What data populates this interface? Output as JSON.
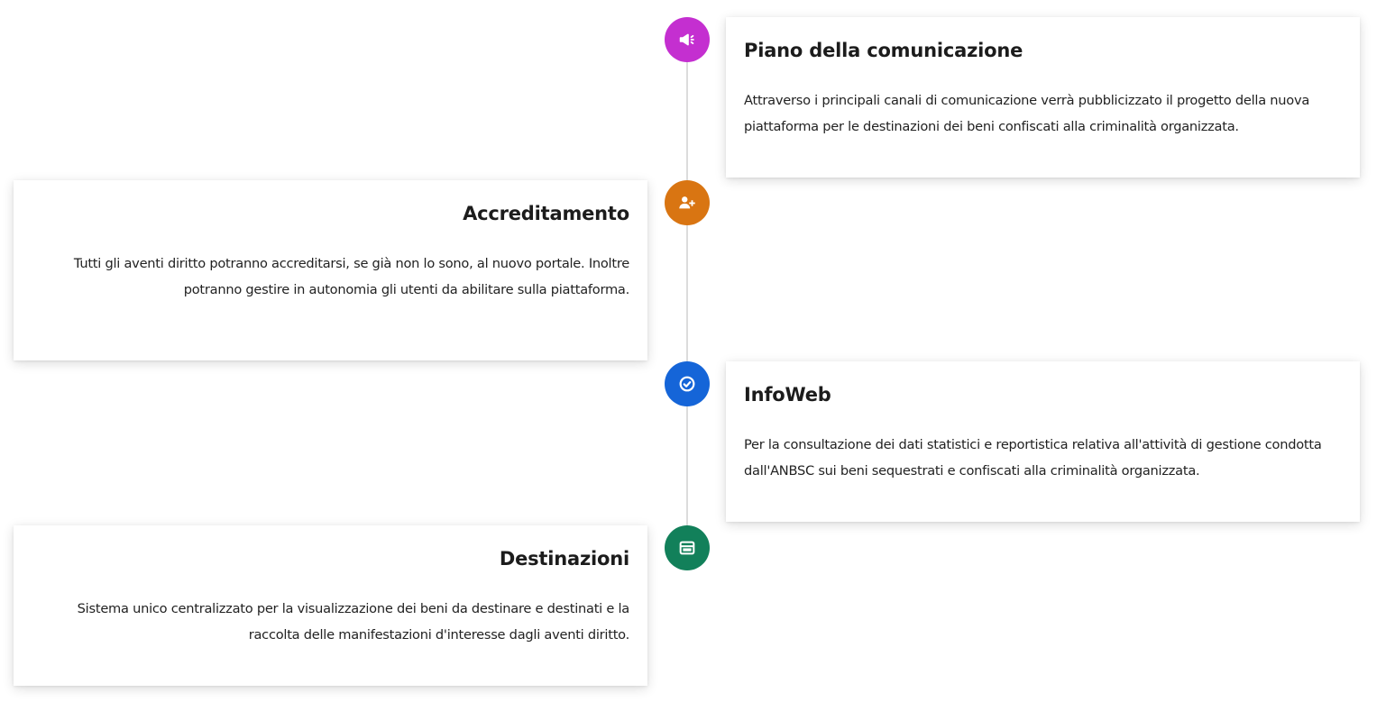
{
  "timeline": {
    "steps": [
      {
        "title": "Piano della comunicazione",
        "text": "Attraverso i principali canali di comunicazione verrà pubblicizzato il progetto della nuova piattaforma per le destinazioni dei beni confiscati alla criminalità organizzata.",
        "icon": "megaphone-icon",
        "color": "#c42fd0"
      },
      {
        "title": "Accreditamento",
        "text": "Tutti gli aventi diritto potranno accreditarsi, se già non lo sono, al nuovo portale. Inoltre potranno gestire in autonomia gli utenti da abilitare sulla piattaforma.",
        "icon": "user-add-icon",
        "color": "#d97512"
      },
      {
        "title": "InfoWeb",
        "text": "Per la consultazione dei dati statistici e reportistica relativa all'attività di gestione condotta dall'ANBSC sui beni sequestrati e confiscati alla criminalità organizzata.",
        "icon": "check-circle-icon",
        "color": "#1565d8"
      },
      {
        "title": "Destinazioni",
        "text": "Sistema unico centralizzato per la visualizzazione dei beni da destinare e destinati e la raccolta delle manifestazioni d'interesse dagli aventi diritto.",
        "icon": "window-icon",
        "color": "#12805a"
      }
    ]
  }
}
